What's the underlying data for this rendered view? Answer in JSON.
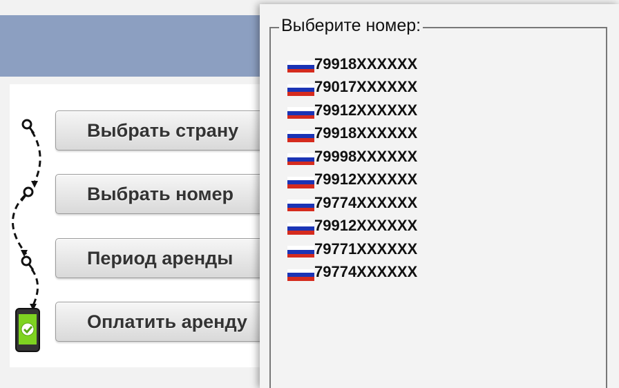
{
  "wizard": {
    "steps": [
      {
        "label": "Выбрать страну"
      },
      {
        "label": "Выбрать номер"
      },
      {
        "label": "Период аренды"
      },
      {
        "label": "Оплатить аренду"
      }
    ]
  },
  "number_picker": {
    "legend": "Выберите номер:",
    "numbers": [
      {
        "value": "79918XXXXXX",
        "flag": "russia-flag"
      },
      {
        "value": "79017XXXXXX",
        "flag": "russia-flag"
      },
      {
        "value": "79912XXXXXX",
        "flag": "russia-flag"
      },
      {
        "value": "79918XXXXXX",
        "flag": "russia-flag"
      },
      {
        "value": "79998XXXXXX",
        "flag": "russia-flag"
      },
      {
        "value": "79912XXXXXX",
        "flag": "russia-flag"
      },
      {
        "value": "79774XXXXXX",
        "flag": "russia-flag"
      },
      {
        "value": "79912XXXXXX",
        "flag": "russia-flag"
      },
      {
        "value": "79771XXXXXX",
        "flag": "russia-flag"
      },
      {
        "value": "79774XXXXXX",
        "flag": "russia-flag"
      }
    ]
  },
  "colors": {
    "header_band": "#8c9fc1",
    "flag_blue": "#1b34b5",
    "flag_red": "#d52b1e",
    "check_green": "#8ccf2c"
  }
}
